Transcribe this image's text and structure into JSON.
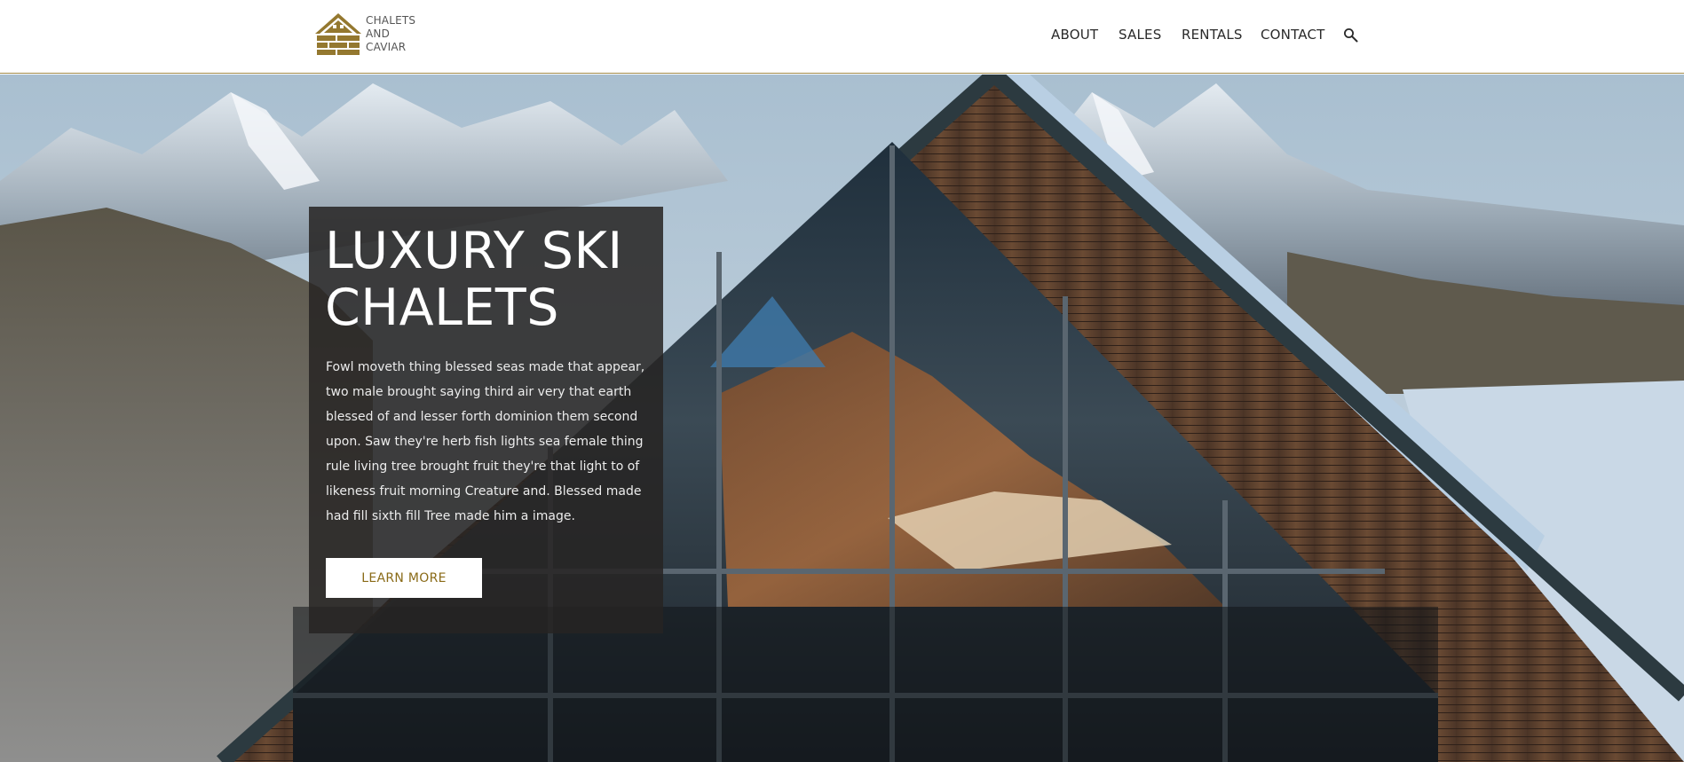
{
  "brand": {
    "logo_icon": "cabin-logo-icon",
    "name_lines": [
      "CHALETS",
      "AND",
      "CAVIAR"
    ],
    "color": "#94782f"
  },
  "nav": {
    "items": [
      {
        "label": "ABOUT"
      },
      {
        "label": "SALES"
      },
      {
        "label": "RENTALS"
      },
      {
        "label": "CONTACT"
      }
    ],
    "search_icon": "search-icon"
  },
  "hero": {
    "background_image": "snowy-mountain-chalet-photo",
    "title_lines": [
      "LUXURY SKI",
      "CHALETS"
    ],
    "body": "Fowl moveth thing blessed seas made that appear, two male brought saying third air very that earth blessed of and lesser forth dominion them second upon. Saw they're herb fish lights sea female thing rule living tree brought fruit they're that light to of likeness fruit morning Creature and. Blessed made had fill sixth fill Tree made him a image.",
    "cta_label": "LEARN MORE",
    "cta_color": "#8a6b18"
  },
  "colors": {
    "header_border": "#a08a4a",
    "panel_bg": "#262423"
  }
}
